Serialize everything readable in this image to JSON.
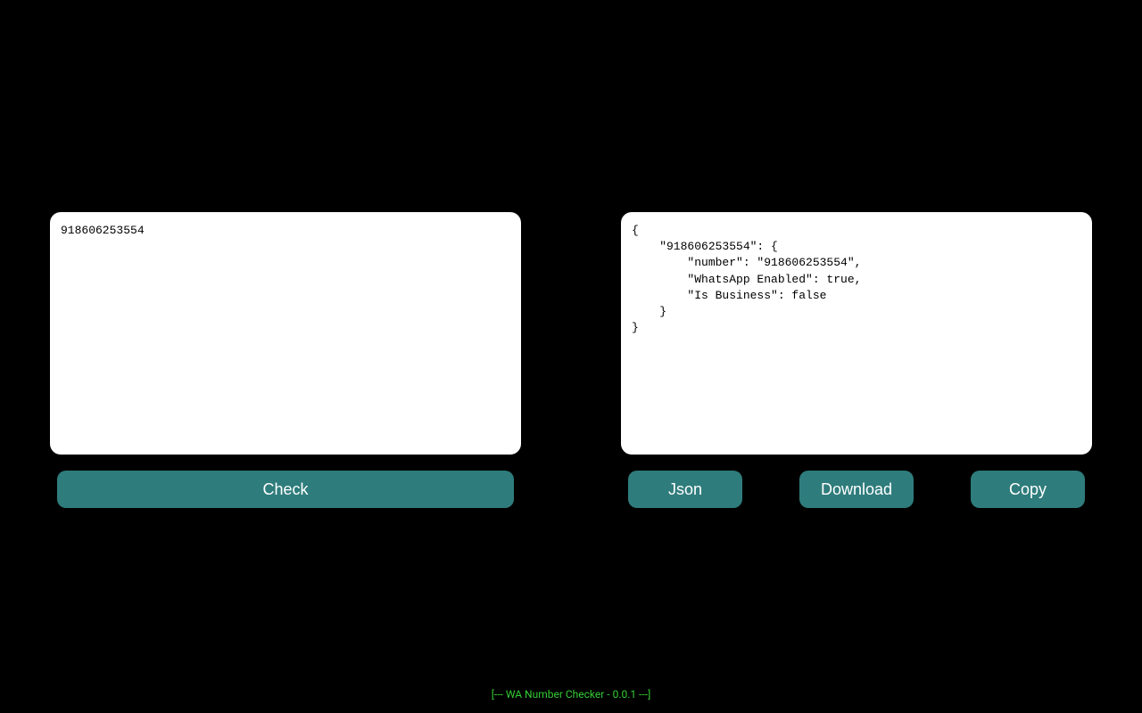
{
  "input": {
    "value": "918606253554"
  },
  "output": {
    "value": "{\n    \"918606253554\": {\n        \"number\": \"918606253554\",\n        \"WhatsApp Enabled\": true,\n        \"Is Business\": false\n    }\n}"
  },
  "buttons": {
    "check": "Check",
    "json": "Json",
    "download": "Download",
    "copy": "Copy"
  },
  "footer": {
    "text": "[--- WA Number Checker - 0.0.1 ---]"
  }
}
